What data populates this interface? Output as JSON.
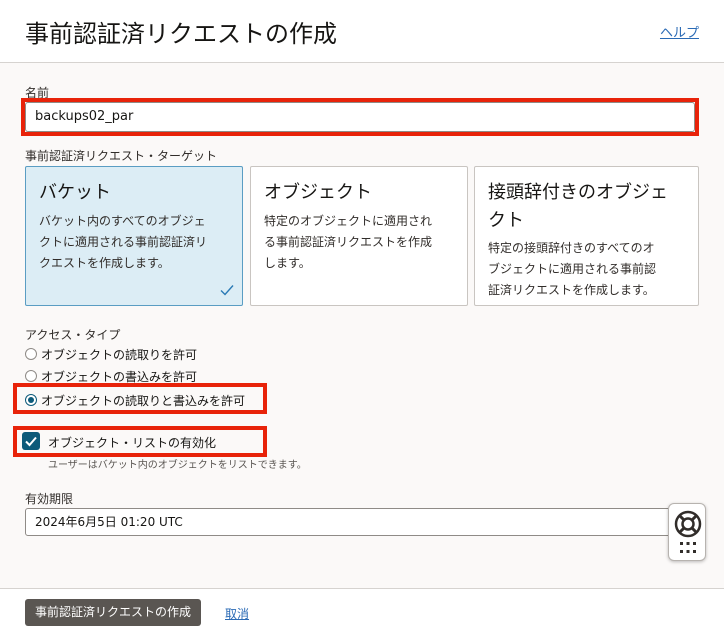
{
  "header": {
    "title": "事前認証済リクエストの作成",
    "help_link": "ヘルプ"
  },
  "name_field": {
    "label": "名前",
    "value": "backups02_par"
  },
  "target": {
    "label": "事前認証済リクエスト・ターゲット",
    "options": [
      {
        "title": "バケット",
        "description_lines": [
          "バケット内のすべてのオブジェ",
          "クトに適用される事前認証済リ",
          "クエストを作成します。"
        ],
        "selected": true
      },
      {
        "title": "オブジェクト",
        "description_lines": [
          "特定のオブジェクトに適用され",
          "る事前認証済リクエストを作成",
          "します。"
        ],
        "selected": false
      },
      {
        "title_lines": [
          "接頭辞付きのオブジェ",
          "クト"
        ],
        "description_lines": [
          "特定の接頭辞付きのすべてのオ",
          "ブジェクトに適用される事前認",
          "証済リクエストを作成します。"
        ],
        "selected": false
      }
    ]
  },
  "access_type": {
    "label": "アクセス・タイプ",
    "options": [
      {
        "label": "オブジェクトの読取りを許可",
        "checked": false
      },
      {
        "label": "オブジェクトの書込みを許可",
        "checked": false
      },
      {
        "label": "オブジェクトの読取りと書込みを許可",
        "checked": true
      }
    ]
  },
  "object_listing": {
    "label": "オブジェクト・リストの有効化",
    "help": "ユーザーはバケット内のオブジェクトをリストできます。",
    "checked": true
  },
  "expiration": {
    "label": "有効期限",
    "value": "2024年6月5日 01:20 UTC"
  },
  "footer": {
    "create_button": "事前認証済リクエストの作成",
    "cancel_link": "取消"
  },
  "colors": {
    "highlight": "#e8230a",
    "selected_card_bg": "#dcedf5",
    "accent": "#0c5a7a",
    "link": "#2a6ab5"
  },
  "icons": [
    "checkmark-icon",
    "lifebuoy-icon",
    "grid-dots-icon"
  ]
}
